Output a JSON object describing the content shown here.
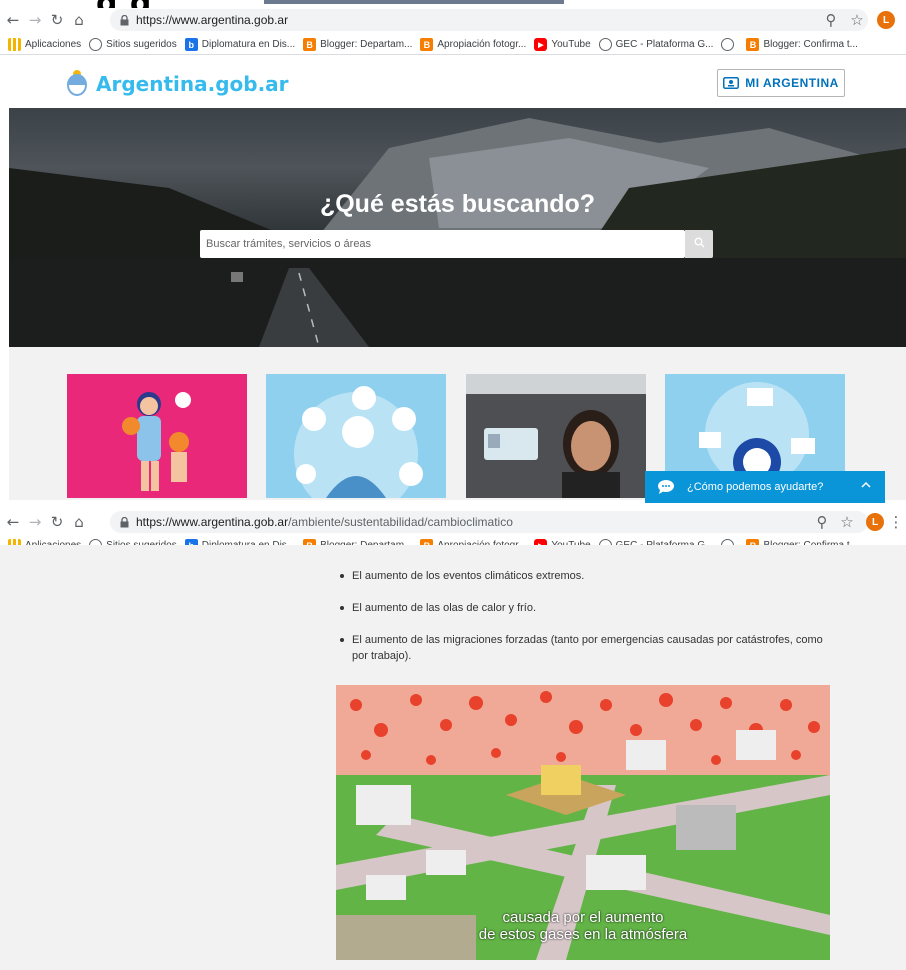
{
  "header_partial": "g    g",
  "browser1": {
    "url_host": "https://www.argentina.gob.ar",
    "url_path": "",
    "avatar": "L"
  },
  "browser2": {
    "url_host": "https://www.argentina.gob.ar",
    "url_path": "/ambiente/sustentabilidad/cambioclimatico",
    "avatar": "L"
  },
  "bookmarks": [
    {
      "label": "Aplicaciones",
      "icon": "apps-grid-icon",
      "color": "#f4b400"
    },
    {
      "label": "Sitios sugeridos",
      "icon": "globe-icon",
      "color": "#5f6368"
    },
    {
      "label": "Diplomatura en Dis...",
      "icon": "b-icon",
      "color": "#1a73e8"
    },
    {
      "label": "Blogger: Departam...",
      "icon": "blogger-icon",
      "color": "#f57d00"
    },
    {
      "label": "Apropiación fotogr...",
      "icon": "blogger-icon",
      "color": "#f57d00"
    },
    {
      "label": "YouTube",
      "icon": "youtube-icon",
      "color": "#ff0000"
    },
    {
      "label": "GEC - Plataforma G...",
      "icon": "globe-icon",
      "color": "#5f6368"
    },
    {
      "label": "",
      "icon": "globe-icon",
      "color": "#5f6368"
    },
    {
      "label": "Blogger: Confirma t...",
      "icon": "blogger-icon",
      "color": "#f57d00"
    }
  ],
  "site": {
    "logo": "Argentina.gob.ar",
    "mi_argentina": "MI ARGENTINA",
    "hero_title": "¿Qué estás buscando?",
    "search_placeholder": "Buscar trámites, servicios o áreas",
    "chat_label": "¿Cómo podemos ayudarte?",
    "brand_color": "#37bbed",
    "chat_color": "#0a95d8"
  },
  "article": {
    "bullets": [
      "El aumento de los eventos climáticos extremos.",
      "El aumento de las olas de calor y frío.",
      "El aumento de las migraciones forzadas (tanto por emergencias causadas por catástrofes, como por trabajo)."
    ],
    "video_subtitle_1": "causada por el aumento",
    "video_subtitle_2": "de estos gases en la atmósfera"
  }
}
